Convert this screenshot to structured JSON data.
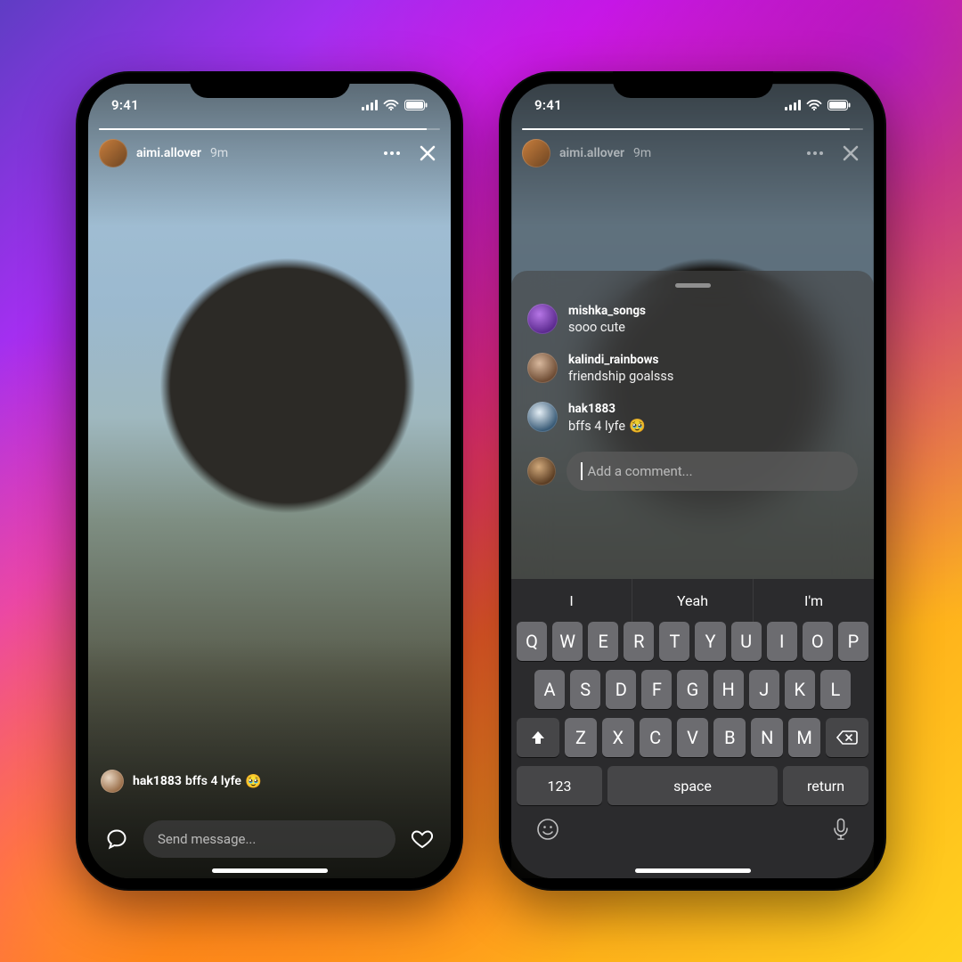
{
  "status": {
    "time": "9:41"
  },
  "story": {
    "username": "aimi.allover",
    "time": "9m",
    "caption_user": "hak1883",
    "caption_text": "bffs 4 lyfe",
    "caption_emoji": "🥹",
    "send_placeholder": "Send message..."
  },
  "sheet": {
    "comments": [
      {
        "user": "mishka_songs",
        "text": "sooo cute",
        "emoji": ""
      },
      {
        "user": "kalindi_rainbows",
        "text": "friendship goalsss",
        "emoji": ""
      },
      {
        "user": "hak1883",
        "text": "bffs 4 lyfe",
        "emoji": "🥹"
      }
    ],
    "input_placeholder": "Add a comment..."
  },
  "keyboard": {
    "suggestions": [
      "I",
      "Yeah",
      "I'm"
    ],
    "row1": [
      "Q",
      "W",
      "E",
      "R",
      "T",
      "Y",
      "U",
      "I",
      "O",
      "P"
    ],
    "row2": [
      "A",
      "S",
      "D",
      "F",
      "G",
      "H",
      "J",
      "K",
      "L"
    ],
    "row3": [
      "Z",
      "X",
      "C",
      "V",
      "B",
      "N",
      "M"
    ],
    "numbers_label": "123",
    "space_label": "space",
    "return_label": "return"
  }
}
